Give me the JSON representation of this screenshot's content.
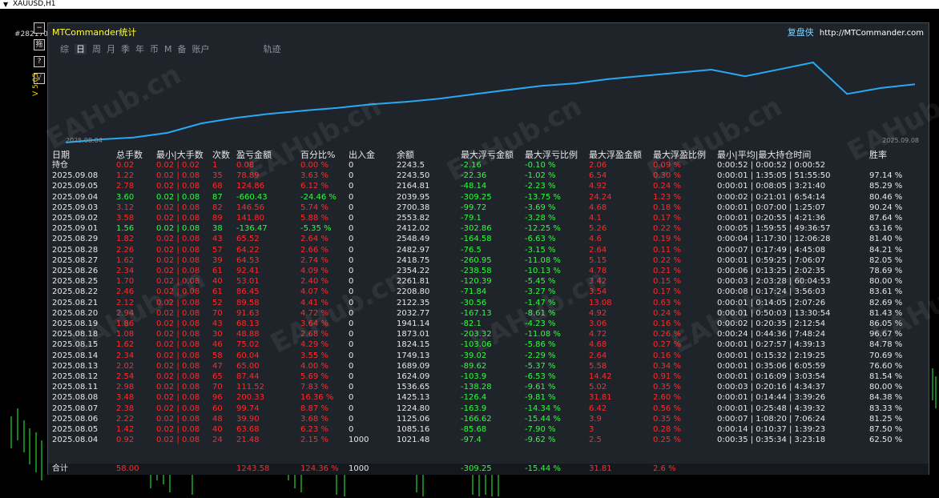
{
  "window": {
    "title": "XAUUSD,H1",
    "ticket": "#2821707"
  },
  "side_buttons": [
    "−",
    "拖",
    "?",
    "√"
  ],
  "volume_label": "V 5.05",
  "panel": {
    "title": "MTCommander统计",
    "brand": "复盘侠",
    "url": "http://MTCommander.com",
    "tabs": [
      "综",
      "日",
      "周",
      "月",
      "季",
      "年",
      "币",
      "M",
      "备",
      "账户",
      "轨迹"
    ],
    "active_tab": "日",
    "curve_start": "2025.08.04",
    "curve_end": "2025.09.08",
    "headers": [
      "日期",
      "总手数",
      "最小|大手数",
      "次数",
      "盈亏金额",
      "百分比%",
      "出入金",
      "余额",
      "最大浮亏金额",
      "最大浮亏比例",
      "最大浮盈金额",
      "最大浮盈比例",
      "最小|平均|最大持仓时间",
      "胜率"
    ],
    "rows": [
      [
        "持仓",
        "0.02",
        "0.02 | 0.02",
        "1",
        "0.08",
        "0.00 %",
        "0",
        "2243.5",
        "-2.16",
        "-0.10 %",
        "2.06",
        "0.09 %",
        "0:00:52 | 0:00:52 | 0:00:52",
        ""
      ],
      [
        "2025.09.08",
        "1.22",
        "0.02 | 0.08",
        "35",
        "78.89",
        "3.63 %",
        "0",
        "2243.50",
        "-22.36",
        "-1.02 %",
        "6.54",
        "0.30 %",
        "0:00:01 | 1:35:05 | 51:55:50",
        "97.14 %"
      ],
      [
        "2025.09.05",
        "2.78",
        "0.02 | 0.08",
        "68",
        "124.86",
        "6.12 %",
        "0",
        "2164.81",
        "-48.14",
        "-2.23 %",
        "4.92",
        "0.24 %",
        "0:00:01 | 0:08:05 | 3:21:40",
        "85.29 %"
      ],
      [
        "2025.09.04",
        "3.60",
        "0.02 | 0.08",
        "87",
        "-660.43",
        "-24.46 %",
        "0",
        "2039.95",
        "-309.25",
        "-13.75 %",
        "24.24",
        "1.23 %",
        "0:00:02 | 0:21:01 | 6:54:14",
        "80.46 %"
      ],
      [
        "2025.09.03",
        "3.12",
        "0.02 | 0.08",
        "82",
        "146.56",
        "5.74 %",
        "0",
        "2700.38",
        "-99.72",
        "-3.69 %",
        "4.68",
        "0.18 %",
        "0:00:01 | 0:07:00 | 1:25:07",
        "90.24 %"
      ],
      [
        "2025.09.02",
        "3.58",
        "0.02 | 0.08",
        "89",
        "141.80",
        "5.88 %",
        "0",
        "2553.82",
        "-79.1",
        "-3.28 %",
        "4.1",
        "0.17 %",
        "0:00:01 | 0:20:55 | 4:21:36",
        "87.64 %"
      ],
      [
        "2025.09.01",
        "1.56",
        "0.02 | 0.08",
        "38",
        "-136.47",
        "-5.35 %",
        "0",
        "2412.02",
        "-302.86",
        "-12.25 %",
        "5.26",
        "0.22 %",
        "0:00:05 | 1:59:55 | 49:36:57",
        "63.16 %"
      ],
      [
        "2025.08.29",
        "1.82",
        "0.02 | 0.08",
        "43",
        "65.52",
        "2.64 %",
        "0",
        "2548.49",
        "-164.58",
        "-6.63 %",
        "4.6",
        "0.19 %",
        "0:00:04 | 1:17:30 | 12:06:28",
        "81.40 %"
      ],
      [
        "2025.08.28",
        "2.26",
        "0.02 | 0.08",
        "57",
        "64.22",
        "2.66 %",
        "0",
        "2482.97",
        "-76.5",
        "-3.15 %",
        "2.64",
        "0.11 %",
        "0:00:07 | 0:17:49 | 4:45:08",
        "84.21 %"
      ],
      [
        "2025.08.27",
        "1.62",
        "0.02 | 0.08",
        "39",
        "64.53",
        "2.74 %",
        "0",
        "2418.75",
        "-260.95",
        "-11.08 %",
        "5.15",
        "0.22 %",
        "0:00:01 | 0:59:25 | 7:06:07",
        "82.05 %"
      ],
      [
        "2025.08.26",
        "2.34",
        "0.02 | 0.08",
        "61",
        "92.41",
        "4.09 %",
        "0",
        "2354.22",
        "-238.58",
        "-10.13 %",
        "4.78",
        "0.21 %",
        "0:00:06 | 0:13:25 | 2:02:35",
        "78.69 %"
      ],
      [
        "2025.08.25",
        "1.70",
        "0.02 | 0.08",
        "40",
        "53.01",
        "2.40 %",
        "0",
        "2261.81",
        "-120.39",
        "-5.45 %",
        "3.42",
        "0.15 %",
        "0:00:03 | 2:03:28 | 60:04:53",
        "80.00 %"
      ],
      [
        "2025.08.22",
        "2.46",
        "0.02 | 0.08",
        "61",
        "86.45",
        "4.07 %",
        "0",
        "2208.80",
        "-71.84",
        "-3.27 %",
        "3.54",
        "0.17 %",
        "0:00:08 | 0:17:24 | 3:56:03",
        "83.61 %"
      ],
      [
        "2025.08.21",
        "2.12",
        "0.02 | 0.08",
        "52",
        "89.58",
        "4.41 %",
        "0",
        "2122.35",
        "-30.56",
        "-1.47 %",
        "13.08",
        "0.63 %",
        "0:00:01 | 0:14:05 | 2:07:26",
        "82.69 %"
      ],
      [
        "2025.08.20",
        "2.94",
        "0.02 | 0.08",
        "70",
        "91.63",
        "4.72 %",
        "0",
        "2032.77",
        "-167.13",
        "-8.61 %",
        "4.92",
        "0.24 %",
        "0:00:01 | 0:50:03 | 13:30:54",
        "81.43 %"
      ],
      [
        "2025.08.19",
        "1.86",
        "0.02 | 0.08",
        "43",
        "68.13",
        "3.64 %",
        "0",
        "1941.14",
        "-82.1",
        "-4.23 %",
        "3.06",
        "0.16 %",
        "0:00:02 | 0:20:35 | 2:12:54",
        "86.05 %"
      ],
      [
        "2025.08.18",
        "1.08",
        "0.02 | 0.08",
        "30",
        "48.88",
        "2.68 %",
        "0",
        "1873.01",
        "-203.32",
        "-11.08 %",
        "4.72",
        "0.26 %",
        "0:00:24 | 0:44:36 | 7:48:24",
        "96.67 %"
      ],
      [
        "2025.08.15",
        "1.62",
        "0.02 | 0.08",
        "46",
        "75.02",
        "4.29 %",
        "0",
        "1824.15",
        "-103.06",
        "-5.86 %",
        "4.68",
        "0.27 %",
        "0:00:01 | 0:27:57 | 4:39:13",
        "84.78 %"
      ],
      [
        "2025.08.14",
        "2.34",
        "0.02 | 0.08",
        "58",
        "60.04",
        "3.55 %",
        "0",
        "1749.13",
        "-39.02",
        "-2.29 %",
        "2.64",
        "0.16 %",
        "0:00:01 | 0:15:32 | 2:19:25",
        "70.69 %"
      ],
      [
        "2025.08.13",
        "2.02",
        "0.02 | 0.08",
        "47",
        "65.00",
        "4.00 %",
        "0",
        "1689.09",
        "-89.62",
        "-5.37 %",
        "5.58",
        "0.34 %",
        "0:00:01 | 0:35:06 | 6:05:59",
        "76.60 %"
      ],
      [
        "2025.08.12",
        "2.54",
        "0.02 | 0.08",
        "65",
        "87.44",
        "5.69 %",
        "0",
        "1624.09",
        "-103.9",
        "-6.53 %",
        "14.42",
        "0.91 %",
        "0:00:01 | 0:16:09 | 3:03:54",
        "81.54 %"
      ],
      [
        "2025.08.11",
        "2.98",
        "0.02 | 0.08",
        "70",
        "111.52",
        "7.83 %",
        "0",
        "1536.65",
        "-138.28",
        "-9.61 %",
        "5.02",
        "0.35 %",
        "0:00:03 | 0:20:16 | 4:34:37",
        "80.00 %"
      ],
      [
        "2025.08.08",
        "3.48",
        "0.02 | 0.08",
        "96",
        "200.33",
        "16.36 %",
        "0",
        "1425.13",
        "-126.4",
        "-9.81 %",
        "31.81",
        "2.60 %",
        "0:00:01 | 0:14:44 | 3:39:26",
        "84.38 %"
      ],
      [
        "2025.08.07",
        "2.38",
        "0.02 | 0.08",
        "60",
        "99.74",
        "8.87 %",
        "0",
        "1224.80",
        "-163.9",
        "-14.34 %",
        "6.42",
        "0.56 %",
        "0:00:01 | 0:25:48 | 4:39:32",
        "83.33 %"
      ],
      [
        "2025.08.06",
        "2.22",
        "0.02 | 0.08",
        "48",
        "39.90",
        "3.68 %",
        "0",
        "1125.06",
        "-166.62",
        "-15.44 %",
        "3.9",
        "0.35 %",
        "0:00:07 | 1:08:20 | 7:06:24",
        "81.25 %"
      ],
      [
        "2025.08.05",
        "1.42",
        "0.02 | 0.08",
        "40",
        "63.68",
        "6.23 %",
        "0",
        "1085.16",
        "-85.68",
        "-7.90 %",
        "3",
        "0.28 %",
        "0:00:14 | 0:10:37 | 1:39:23",
        "87.50 %"
      ],
      [
        "2025.08.04",
        "0.92",
        "0.02 | 0.08",
        "24",
        "21.48",
        "2.15 %",
        "1000",
        "1021.48",
        "-97.4",
        "-9.62 %",
        "2.5",
        "0.25 %",
        "0:00:35 | 0:35:34 | 3:23:18",
        "62.50 %"
      ]
    ],
    "total": [
      "合计",
      "58.00",
      "",
      "",
      "1243.58",
      "124.36 %",
      "1000",
      "",
      "-309.25",
      "-15.44 %",
      "31.81",
      "2.6 %",
      "",
      ""
    ]
  },
  "equity_curve": [
    1021.48,
    1085.16,
    1125.06,
    1224.8,
    1425.13,
    1536.65,
    1624.09,
    1689.09,
    1749.13,
    1824.15,
    1873.01,
    1941.14,
    2032.77,
    2122.35,
    2208.8,
    2261.81,
    2354.22,
    2418.75,
    2482.97,
    2548.49,
    2412.02,
    2553.82,
    2700.38,
    2039.95,
    2164.81,
    2243.5
  ],
  "colors": {
    "red": "#ff2a2a",
    "green": "#2bff3a",
    "curve": "#29a9f0",
    "panel": "#1f242b",
    "title": "#ffff3a"
  },
  "watermark": "EAHub.cn"
}
